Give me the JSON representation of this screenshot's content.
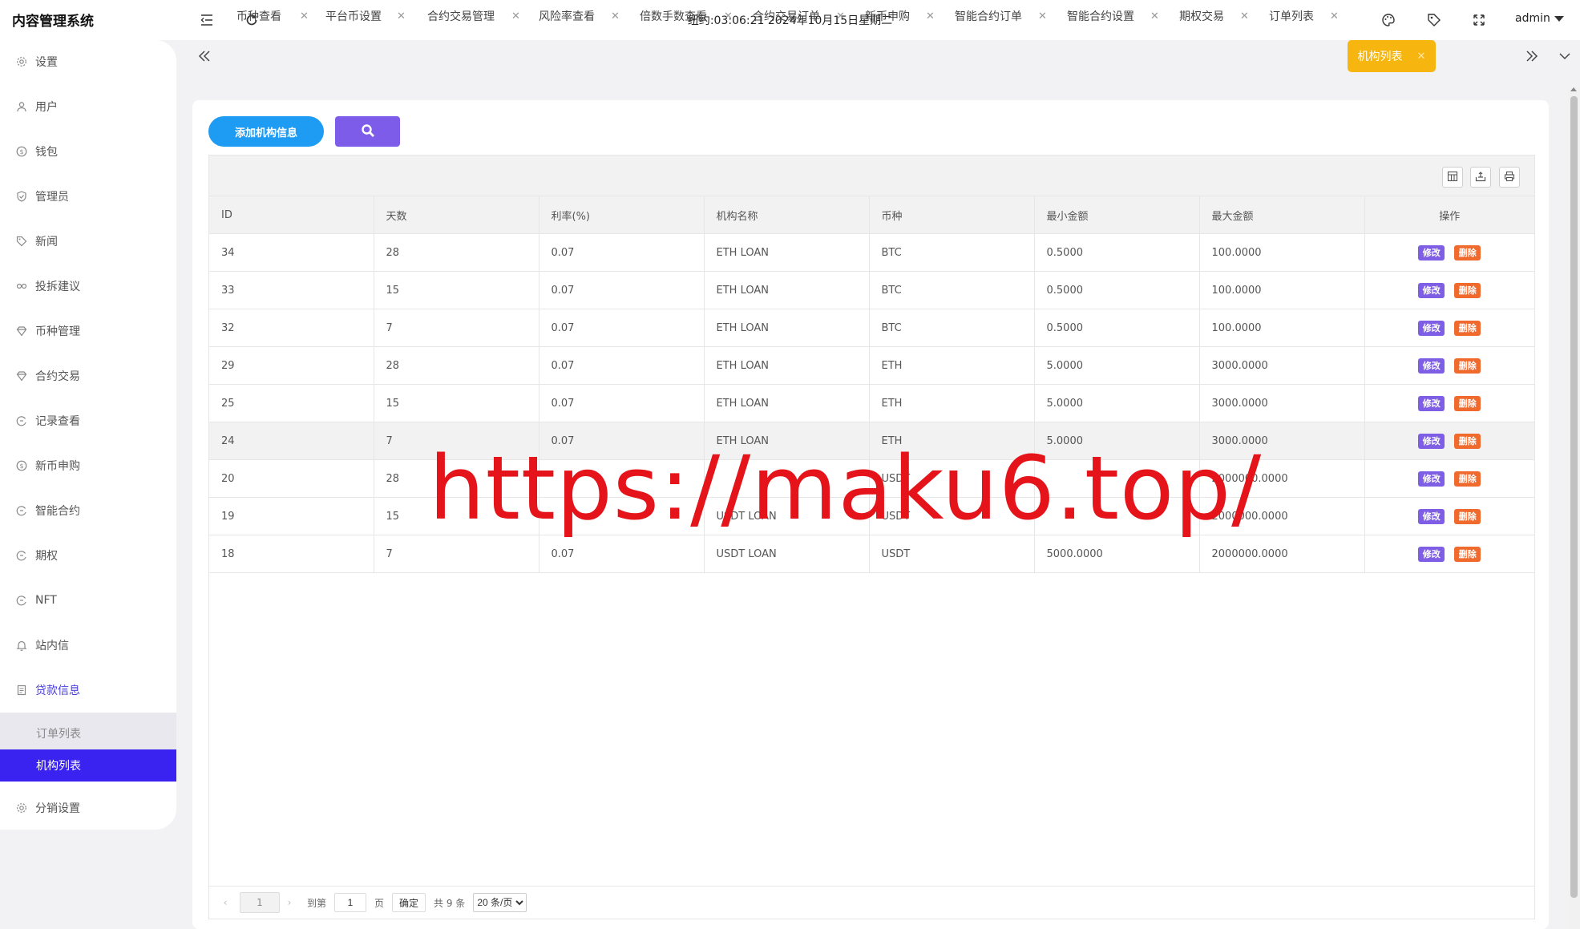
{
  "app": {
    "title": "内容管理系统"
  },
  "header": {
    "datetime": "纽约:03:06:21 2024年10月15日星期二",
    "user": "admin"
  },
  "sidebar": {
    "items": [
      {
        "label": "设置",
        "icon": "gear-icon"
      },
      {
        "label": "用户",
        "icon": "user-icon"
      },
      {
        "label": "钱包",
        "icon": "dollar-icon"
      },
      {
        "label": "管理员",
        "icon": "shield-icon"
      },
      {
        "label": "新闻",
        "icon": "tag-icon"
      },
      {
        "label": "投拆建议",
        "icon": "link-icon"
      },
      {
        "label": "币种管理",
        "icon": "diamond-icon"
      },
      {
        "label": "合约交易",
        "icon": "diamond-icon"
      },
      {
        "label": "记录查看",
        "icon": "circle-arrow-icon"
      },
      {
        "label": "新币申购",
        "icon": "dollar-icon"
      },
      {
        "label": "智能合约",
        "icon": "circle-arrow-icon"
      },
      {
        "label": "期权",
        "icon": "circle-arrow-icon"
      },
      {
        "label": "NFT",
        "icon": "circle-arrow-icon"
      },
      {
        "label": "站内信",
        "icon": "bell-icon"
      },
      {
        "label": "贷款信息",
        "icon": "document-icon"
      },
      {
        "label": "分销设置",
        "icon": "gear-icon"
      }
    ],
    "submenu": [
      {
        "label": "订单列表"
      },
      {
        "label": "机构列表"
      }
    ]
  },
  "tabs": [
    {
      "label": "币种查看"
    },
    {
      "label": "平台币设置"
    },
    {
      "label": "合约交易管理"
    },
    {
      "label": "风险率查看"
    },
    {
      "label": "倍数手数查看"
    },
    {
      "label": "合约交易订单"
    },
    {
      "label": "新币申购"
    },
    {
      "label": "智能合约订单"
    },
    {
      "label": "智能合约设置"
    },
    {
      "label": "期权交易"
    },
    {
      "label": "订单列表"
    },
    {
      "label": "机构列表"
    }
  ],
  "toolbar": {
    "add_label": "添加机构信息"
  },
  "table": {
    "columns": [
      "ID",
      "天数",
      "利率(%)",
      "机构名称",
      "币种",
      "最小金额",
      "最大金额",
      "操作"
    ],
    "rows": [
      [
        "34",
        "28",
        "0.07",
        "ETH LOAN",
        "BTC",
        "0.5000",
        "100.0000"
      ],
      [
        "33",
        "15",
        "0.07",
        "ETH LOAN",
        "BTC",
        "0.5000",
        "100.0000"
      ],
      [
        "32",
        "7",
        "0.07",
        "ETH LOAN",
        "BTC",
        "0.5000",
        "100.0000"
      ],
      [
        "29",
        "28",
        "0.07",
        "ETH LOAN",
        "ETH",
        "5.0000",
        "3000.0000"
      ],
      [
        "25",
        "15",
        "0.07",
        "ETH LOAN",
        "ETH",
        "5.0000",
        "3000.0000"
      ],
      [
        "24",
        "7",
        "0.07",
        "ETH LOAN",
        "ETH",
        "5.0000",
        "3000.0000"
      ],
      [
        "20",
        "28",
        "",
        "",
        "USDT",
        "",
        "2000000.0000"
      ],
      [
        "19",
        "15",
        "",
        "USDT LOAN",
        "USDT",
        "",
        "2000000.0000"
      ],
      [
        "18",
        "7",
        "0.07",
        "USDT LOAN",
        "USDT",
        "5000.0000",
        "2000000.0000"
      ]
    ],
    "edit_label": "修改",
    "delete_label": "删除"
  },
  "pagination": {
    "current": "1",
    "goto_label": "到第",
    "page_input": "1",
    "page_unit": "页",
    "confirm_label": "确定",
    "total": "共 9 条",
    "page_size": "20 条/页"
  },
  "watermark": "https://maku6.top/",
  "colors": {
    "active_tab": "#f6b60f",
    "active_menu": "#3a22f0",
    "add_button": "#1e9bf2",
    "search_button": "#7c5ce8",
    "edit_button": "#7f5ee6",
    "delete_button": "#f06a2e",
    "watermark": "#e5141a"
  }
}
